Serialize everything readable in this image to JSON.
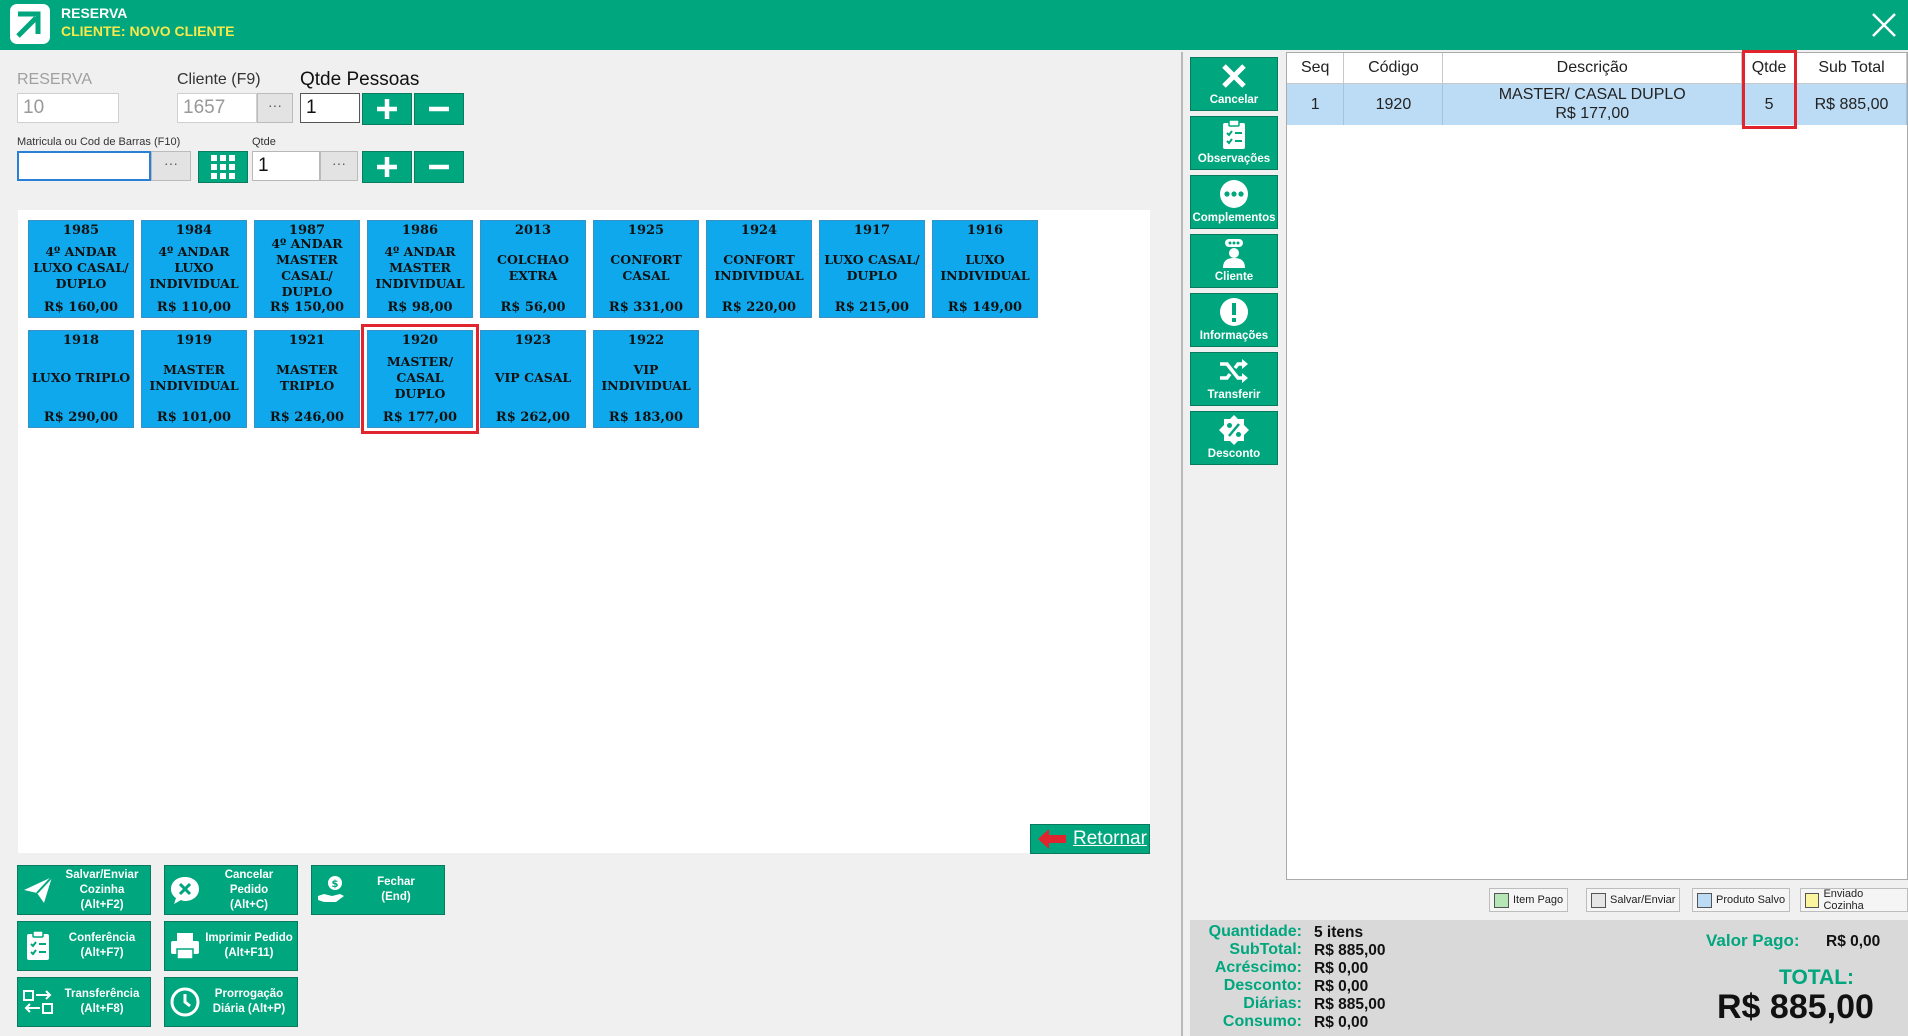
{
  "window": {
    "title": "RESERVA",
    "subtitle": "CLIENTE: NOVO CLIENTE"
  },
  "form": {
    "reserva_label": "RESERVA",
    "reserva_value": "10",
    "cliente_label": "Cliente (F9)",
    "cliente_value": "1657",
    "pessoas_label": "Qtde Pessoas",
    "pessoas_value": "1",
    "matricula_label": "Matricula ou Cod de Barras (F10)",
    "matricula_value": "",
    "qtde_label": "Qtde",
    "qtde_value": "1",
    "dots": "···"
  },
  "products": [
    {
      "code": "1985",
      "name": "4º ANDAR LUXO CASAL/ DUPLO",
      "price": "R$ 160,00",
      "selected": false
    },
    {
      "code": "1984",
      "name": "4º ANDAR LUXO INDIVIDUAL",
      "price": "R$ 110,00",
      "selected": false
    },
    {
      "code": "1987",
      "name": "4º ANDAR MASTER CASAL/ DUPLO",
      "price": "R$ 150,00",
      "selected": false
    },
    {
      "code": "1986",
      "name": "4º ANDAR MASTER INDIVIDUAL",
      "price": "R$ 98,00",
      "selected": false
    },
    {
      "code": "2013",
      "name": "COLCHAO EXTRA",
      "price": "R$ 56,00",
      "selected": false
    },
    {
      "code": "1925",
      "name": "CONFORT CASAL",
      "price": "R$ 331,00",
      "selected": false
    },
    {
      "code": "1924",
      "name": "CONFORT INDIVIDUAL",
      "price": "R$ 220,00",
      "selected": false
    },
    {
      "code": "1917",
      "name": "LUXO CASAL/ DUPLO",
      "price": "R$ 215,00",
      "selected": false
    },
    {
      "code": "1916",
      "name": "LUXO INDIVIDUAL",
      "price": "R$ 149,00",
      "selected": false
    },
    {
      "code": "1918",
      "name": "LUXO TRIPLO",
      "price": "R$ 290,00",
      "selected": false
    },
    {
      "code": "1919",
      "name": "MASTER INDIVIDUAL",
      "price": "R$ 101,00",
      "selected": false
    },
    {
      "code": "1921",
      "name": "MASTER TRIPLO",
      "price": "R$ 246,00",
      "selected": false
    },
    {
      "code": "1920",
      "name": "MASTER/ CASAL DUPLO",
      "price": "R$ 177,00",
      "selected": true
    },
    {
      "code": "1923",
      "name": "VIP CASAL",
      "price": "R$ 262,00",
      "selected": false
    },
    {
      "code": "1922",
      "name": "VIP INDIVIDUAL",
      "price": "R$ 183,00",
      "selected": false
    }
  ],
  "retornar_label": "Retornar",
  "actions": {
    "salvar": [
      "Salvar/Enviar",
      "Cozinha (Alt+F2)"
    ],
    "cancelar": [
      "Cancelar Pedido",
      "(Alt+C)"
    ],
    "fechar": [
      "Fechar",
      "(End)"
    ],
    "conferencia": [
      "Conferência",
      "(Alt+F7)"
    ],
    "imprimir": [
      "Imprimir Pedido",
      "(Alt+F11)"
    ],
    "transferencia": [
      "Transferência",
      "(Alt+F8)"
    ],
    "prorrogacao": [
      "Prorrogação",
      "Diária (Alt+P)"
    ]
  },
  "side_buttons": {
    "cancelar": "Cancelar",
    "observacoes": "Observações",
    "complementos": "Complementos",
    "cliente": "Cliente",
    "informacoes": "Informações",
    "transferir": "Transferir",
    "desconto": "Desconto"
  },
  "table": {
    "headers": {
      "seq": "Seq",
      "codigo": "Código",
      "descricao": "Descrição",
      "qtde": "Qtde",
      "subtotal": "Sub Total"
    },
    "rows": [
      {
        "seq": "1",
        "codigo": "1920",
        "descricao_line1": "MASTER/ CASAL DUPLO",
        "descricao_line2": "R$ 177,00",
        "qtde": "5",
        "subtotal": "R$ 885,00"
      }
    ]
  },
  "legend": {
    "item_pago": "Item Pago",
    "salvar_enviar": "Salvar/Enviar",
    "produto_salvo": "Produto Salvo",
    "enviado_cozinha": "Enviado Cozinha",
    "colors": {
      "item_pago": "#b6e6b6",
      "salvar_enviar": "#e6e6e6",
      "produto_salvo": "#bcdcf5",
      "enviado_cozinha": "#fbf5a0"
    }
  },
  "summary": {
    "quantidade_label": "Quantidade:",
    "quantidade_value": "5 itens",
    "subtotal_label": "SubTotal:",
    "subtotal_value": "R$ 885,00",
    "acrescimo_label": "Acréscimo:",
    "acrescimo_value": "R$ 0,00",
    "desconto_label": "Desconto:",
    "desconto_value": "R$ 0,00",
    "diarias_label": "Diárias:",
    "diarias_value": "R$ 885,00",
    "consumo_label": "Consumo:",
    "consumo_value": "R$ 0,00",
    "valor_pago_label": "Valor Pago:",
    "valor_pago_value": "R$ 0,00",
    "total_label": "TOTAL:",
    "total_value": "R$ 885,00"
  },
  "colors": {
    "brand": "#00a67e",
    "tile": "#10a8ec",
    "highlight": "#e0252f",
    "subtitle": "#f7e94a"
  }
}
